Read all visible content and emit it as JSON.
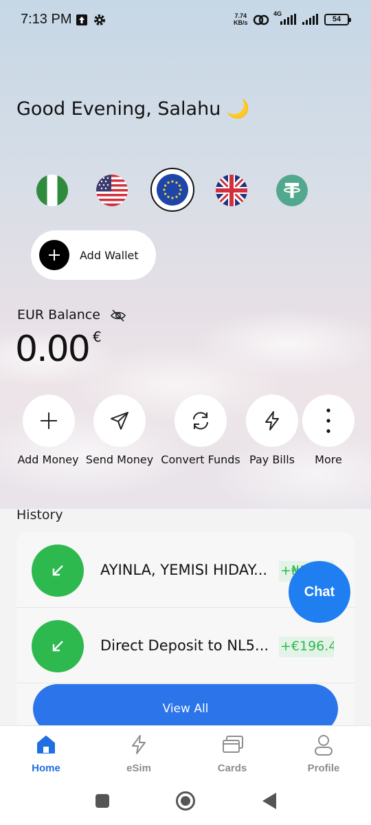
{
  "status_bar": {
    "time": "7:13 PM",
    "net_speed_value": "7.74",
    "net_speed_unit": "KB/s",
    "network_type": "4G",
    "battery": "54"
  },
  "greeting": "Good Evening, Salahu 🌙",
  "currencies": [
    {
      "icon": "nigeria-flag-icon",
      "selected": false
    },
    {
      "icon": "us-flag-icon",
      "selected": false
    },
    {
      "icon": "eu-flag-icon",
      "selected": true
    },
    {
      "icon": "uk-flag-icon",
      "selected": false
    },
    {
      "icon": "tether-icon",
      "selected": false
    }
  ],
  "add_wallet_label": "Add Wallet",
  "balance": {
    "label": "EUR Balance",
    "amount": "0.00",
    "symbol": "€"
  },
  "actions": [
    {
      "label": "Add Money",
      "icon": "plus-icon"
    },
    {
      "label": "Send Money",
      "icon": "send-icon"
    },
    {
      "label": "Convert Funds",
      "icon": "convert-icon"
    },
    {
      "label": "Pay Bills",
      "icon": "lightning-icon"
    },
    {
      "label": "More",
      "icon": "more-vertical-icon"
    }
  ],
  "history": {
    "title": "History",
    "transactions": [
      {
        "name": "AYINLA, YEMISI HIDAY...",
        "amount": "+₦1"
      },
      {
        "name": "Direct Deposit to NL5...",
        "amount": "+€196.4"
      }
    ],
    "view_all_label": "View All"
  },
  "chat_label": "Chat",
  "nav": {
    "items": [
      {
        "label": "Home",
        "icon": "home-icon",
        "active": true
      },
      {
        "label": "eSim",
        "icon": "lightning-icon",
        "active": false
      },
      {
        "label": "Cards",
        "icon": "cards-icon",
        "active": false
      },
      {
        "label": "Profile",
        "icon": "profile-icon",
        "active": false
      }
    ]
  },
  "colors": {
    "accent_blue": "#2b74ea",
    "credit_green": "#2db94d",
    "nav_active": "#1f6fe0"
  }
}
